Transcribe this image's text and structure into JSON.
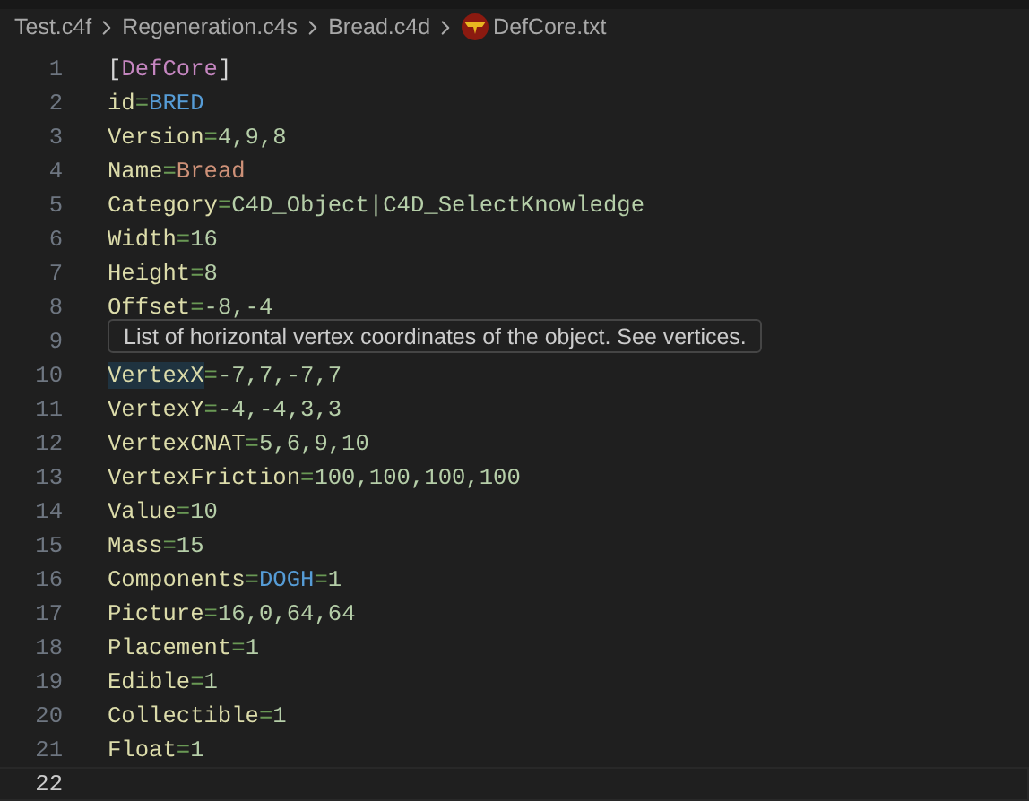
{
  "breadcrumb": [
    {
      "label": "Test.c4f",
      "kind": "folder"
    },
    {
      "label": "Regeneration.c4s",
      "kind": "folder"
    },
    {
      "label": "Bread.c4d",
      "kind": "folder"
    },
    {
      "label": "DefCore.txt",
      "kind": "file"
    }
  ],
  "lines": [
    {
      "number": "1",
      "current": false,
      "tokens": [
        {
          "kind": "bracket",
          "text": "["
        },
        {
          "kind": "section",
          "text": "DefCore"
        },
        {
          "kind": "bracket",
          "text": "]"
        }
      ]
    },
    {
      "number": "2",
      "current": false,
      "tokens": [
        {
          "kind": "key",
          "text": "id"
        },
        {
          "kind": "op",
          "text": "="
        },
        {
          "kind": "ident",
          "text": "BRED"
        }
      ]
    },
    {
      "number": "3",
      "current": false,
      "tokens": [
        {
          "kind": "key",
          "text": "Version"
        },
        {
          "kind": "op",
          "text": "="
        },
        {
          "kind": "number",
          "text": "4,9,8"
        }
      ]
    },
    {
      "number": "4",
      "current": false,
      "tokens": [
        {
          "kind": "key",
          "text": "Name"
        },
        {
          "kind": "op",
          "text": "="
        },
        {
          "kind": "string",
          "text": "Bread"
        }
      ]
    },
    {
      "number": "5",
      "current": false,
      "tokens": [
        {
          "kind": "key",
          "text": "Category"
        },
        {
          "kind": "op",
          "text": "="
        },
        {
          "kind": "number",
          "text": "C4D_Object|C4D_SelectKnowledge"
        }
      ]
    },
    {
      "number": "6",
      "current": false,
      "tokens": [
        {
          "kind": "key",
          "text": "Width"
        },
        {
          "kind": "op",
          "text": "="
        },
        {
          "kind": "number",
          "text": "16"
        }
      ]
    },
    {
      "number": "7",
      "current": false,
      "tokens": [
        {
          "kind": "key",
          "text": "Height"
        },
        {
          "kind": "op",
          "text": "="
        },
        {
          "kind": "number",
          "text": "8"
        }
      ]
    },
    {
      "number": "8",
      "current": false,
      "tokens": [
        {
          "kind": "key",
          "text": "Offset"
        },
        {
          "kind": "op",
          "text": "="
        },
        {
          "kind": "number",
          "text": "-8,-4"
        }
      ]
    },
    {
      "number": "9",
      "current": false
    },
    {
      "number": "10",
      "current": false,
      "tokens": [
        {
          "kind": "key",
          "text": "VertexX",
          "highlighted": true
        },
        {
          "kind": "op",
          "text": "="
        },
        {
          "kind": "number",
          "text": "-7,7,-7,7"
        }
      ]
    },
    {
      "number": "11",
      "current": false,
      "tokens": [
        {
          "kind": "key",
          "text": "VertexY"
        },
        {
          "kind": "op",
          "text": "="
        },
        {
          "kind": "number",
          "text": "-4,-4,3,3"
        }
      ]
    },
    {
      "number": "12",
      "current": false,
      "tokens": [
        {
          "kind": "key",
          "text": "VertexCNAT"
        },
        {
          "kind": "op",
          "text": "="
        },
        {
          "kind": "number",
          "text": "5,6,9,10"
        }
      ]
    },
    {
      "number": "13",
      "current": false,
      "tokens": [
        {
          "kind": "key",
          "text": "VertexFriction"
        },
        {
          "kind": "op",
          "text": "="
        },
        {
          "kind": "number",
          "text": "100,100,100,100"
        }
      ]
    },
    {
      "number": "14",
      "current": false,
      "tokens": [
        {
          "kind": "key",
          "text": "Value"
        },
        {
          "kind": "op",
          "text": "="
        },
        {
          "kind": "number",
          "text": "10"
        }
      ]
    },
    {
      "number": "15",
      "current": false,
      "tokens": [
        {
          "kind": "key",
          "text": "Mass"
        },
        {
          "kind": "op",
          "text": "="
        },
        {
          "kind": "number",
          "text": "15"
        }
      ]
    },
    {
      "number": "16",
      "current": false,
      "tokens": [
        {
          "kind": "key",
          "text": "Components"
        },
        {
          "kind": "op",
          "text": "="
        },
        {
          "kind": "ident",
          "text": "DOGH"
        },
        {
          "kind": "op",
          "text": "="
        },
        {
          "kind": "number",
          "text": "1"
        }
      ]
    },
    {
      "number": "17",
      "current": false,
      "tokens": [
        {
          "kind": "key",
          "text": "Picture"
        },
        {
          "kind": "op",
          "text": "="
        },
        {
          "kind": "number",
          "text": "16,0,64,64"
        }
      ]
    },
    {
      "number": "18",
      "current": false,
      "tokens": [
        {
          "kind": "key",
          "text": "Placement"
        },
        {
          "kind": "op",
          "text": "="
        },
        {
          "kind": "number",
          "text": "1"
        }
      ]
    },
    {
      "number": "19",
      "current": false,
      "tokens": [
        {
          "kind": "key",
          "text": "Edible"
        },
        {
          "kind": "op",
          "text": "="
        },
        {
          "kind": "number",
          "text": "1"
        }
      ]
    },
    {
      "number": "20",
      "current": false,
      "tokens": [
        {
          "kind": "key",
          "text": "Collectible"
        },
        {
          "kind": "op",
          "text": "="
        },
        {
          "kind": "number",
          "text": "1"
        }
      ]
    },
    {
      "number": "21",
      "current": false,
      "tokens": [
        {
          "kind": "key",
          "text": "Float"
        },
        {
          "kind": "op",
          "text": "="
        },
        {
          "kind": "number",
          "text": "1"
        }
      ]
    },
    {
      "number": "22",
      "current": true
    }
  ],
  "tooltip": {
    "text": "List of horizontal vertex coordinates of the object. See vertices."
  }
}
